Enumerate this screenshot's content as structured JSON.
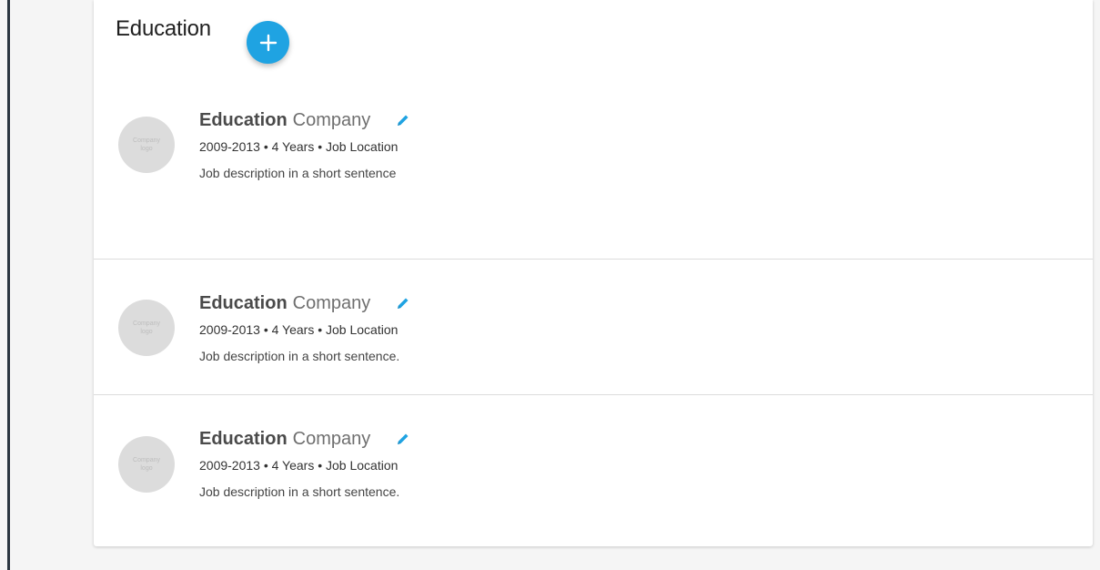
{
  "colors": {
    "accent": "#1fa3e2",
    "card_background": "#ffffff",
    "page_background": "#f5f5f5",
    "logo_placeholder": "#dcdcdc",
    "divider": "#dcdcdc"
  },
  "section": {
    "title": "Education",
    "add_icon": "plus-icon"
  },
  "entries": [
    {
      "logo_text": "Company logo",
      "title": "Education",
      "company": "Company",
      "edit_icon": "pencil-icon",
      "meta": "2009-2013 • 4 Years • Job Location",
      "description": "Job description in a short sentence"
    },
    {
      "logo_text": "Company logo",
      "title": "Education",
      "company": "Company",
      "edit_icon": "pencil-icon",
      "meta": "2009-2013 • 4 Years • Job Location",
      "description": "Job description in a short sentence."
    },
    {
      "logo_text": "Company logo",
      "title": "Education",
      "company": "Company",
      "edit_icon": "pencil-icon",
      "meta": "2009-2013 • 4 Years • Job Location",
      "description": "Job description in a short sentence."
    }
  ]
}
